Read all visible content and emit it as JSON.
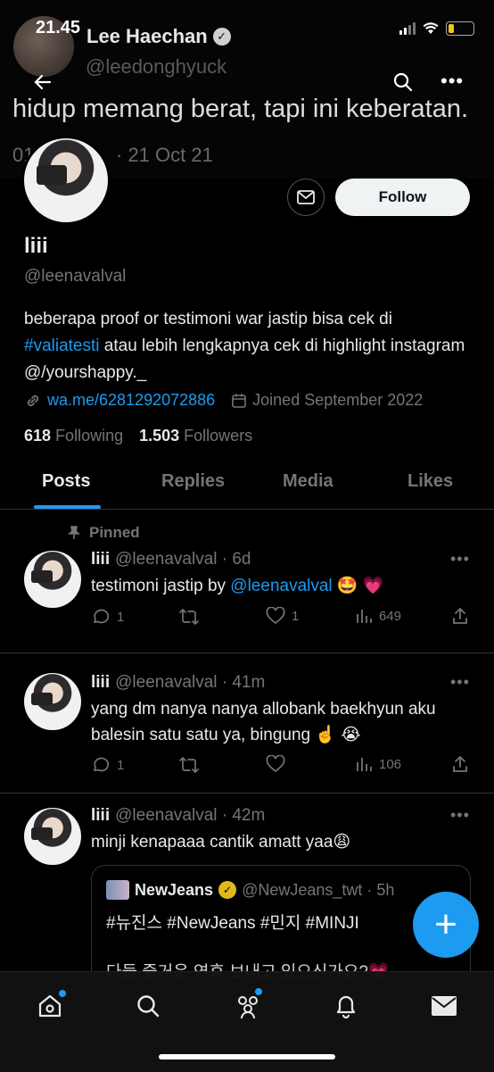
{
  "status_bar": {
    "time": "21.45"
  },
  "banner": {
    "name": "Lee Haechan",
    "handle": "@leedonghyuck",
    "quote": "hidup memang berat, tapi ini keberatan.",
    "date_left": "01",
    "date": "· 21 Oct 21"
  },
  "nav": {
    "back_icon": "arrow-left-icon",
    "search_icon": "search-icon",
    "more_icon": "more-icon",
    "more_label": "•••"
  },
  "profile": {
    "follow_label": "Follow",
    "display_name": "liii",
    "handle": "@leenavalval",
    "bio_1": "beberapa proof or testimoni war jastip bisa cek di ",
    "bio_tag": "#valiatesti",
    "bio_2": " atau lebih lengkapnya cek di highlight instagram @/yourshappy._",
    "link": "wa.me/6281292072886",
    "joined": "Joined September 2022",
    "following_count": "618",
    "following_label": "Following",
    "followers_count": "1.503",
    "followers_label": "Followers"
  },
  "tabs": [
    {
      "label": "Posts"
    },
    {
      "label": "Replies"
    },
    {
      "label": "Media"
    },
    {
      "label": "Likes"
    }
  ],
  "posts": [
    {
      "pinned_label": "Pinned",
      "name": "liii",
      "meta": "@leenavalval · 6d",
      "text_1": "testimoni jastip by ",
      "mention": "@leenavalval",
      "text_2": " 🤩 💗",
      "replies": "1",
      "reposts": "",
      "likes": "1",
      "views": "649"
    },
    {
      "name": "liii",
      "meta": "@leenavalval · 41m",
      "text": "yang dm nanya nanya allobank baekhyun aku balesin satu satu ya, bingung ☝️ 😭",
      "replies": "1",
      "reposts": "",
      "likes": "",
      "views": "106"
    },
    {
      "name": "liii",
      "meta": "@leenavalval · 42m",
      "text": "minji kenapaaa cantik amatt yaa😩",
      "quote": {
        "name": "NewJeans",
        "meta": "@NewJeans_twt · 5h",
        "text": "#뉴진스 #NewJeans #민지 #MINJI",
        "text2": "다들 즐거운 연휴 보내고 있으신가요?💗"
      }
    }
  ],
  "fab_label": "+",
  "colors": {
    "accent": "#1d9bf0",
    "background": "#000000",
    "muted": "#71767b",
    "text": "#e7e9ea"
  }
}
